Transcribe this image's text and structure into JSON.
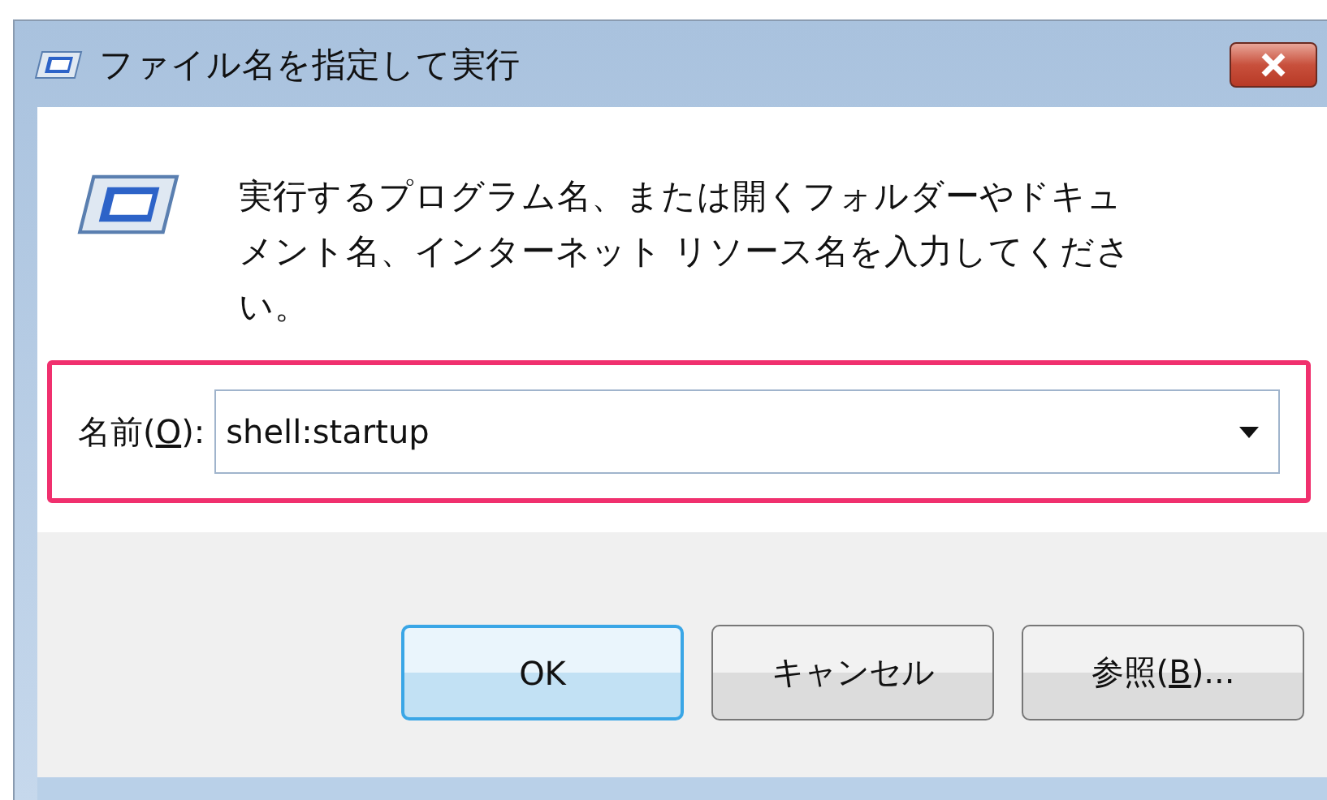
{
  "window": {
    "title": "ファイル名を指定して実行"
  },
  "description": "実行するプログラム名、または開くフォルダーやドキュメント名、インターネット リソース名を入力してください。",
  "name_field": {
    "label": "名前(O):",
    "value": "shell:startup",
    "highlighted": true
  },
  "buttons": [
    {
      "label": "OK",
      "default": true
    },
    {
      "label": "キャンセル",
      "default": false
    },
    {
      "label": "参照(B)...",
      "default": false
    }
  ]
}
